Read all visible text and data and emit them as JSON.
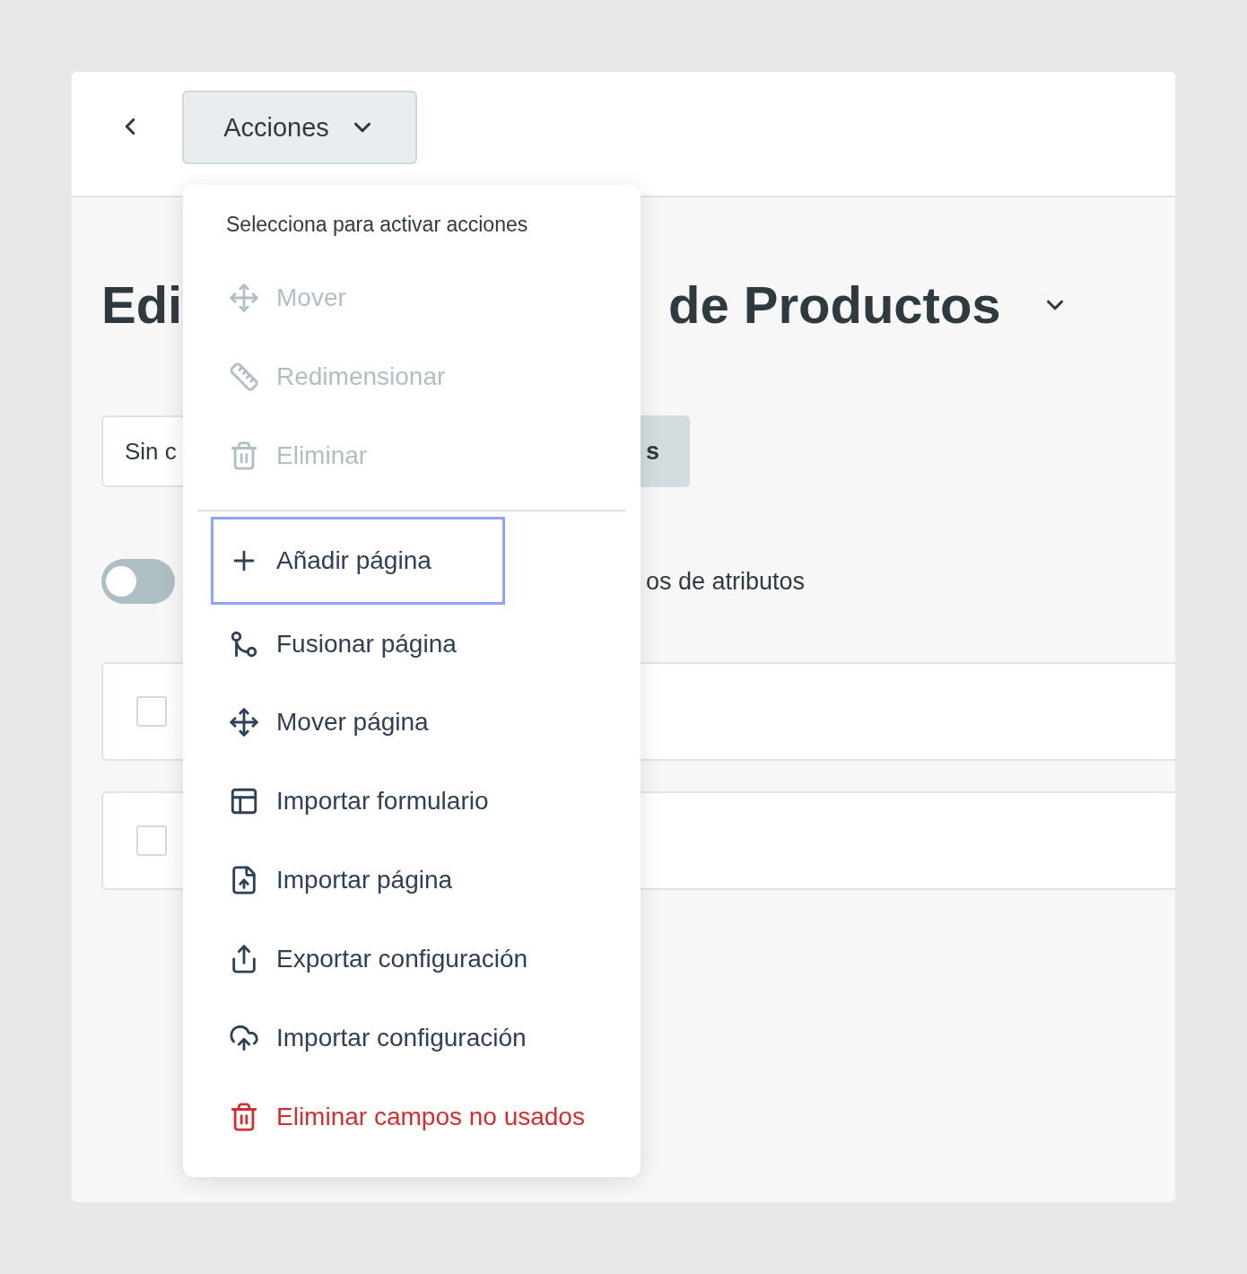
{
  "header": {
    "actions_button": {
      "label": "Acciones"
    }
  },
  "title": {
    "left": "Edi",
    "right": "de Productos"
  },
  "filter_field": {
    "value": "Sin c"
  },
  "filter_button": {
    "label": "s"
  },
  "toggle": {
    "on": false,
    "label": "os de atributos"
  },
  "rows": [
    {
      "checked": false
    },
    {
      "checked": false
    }
  ],
  "menu": {
    "header": "Selecciona para activar acciones",
    "groups": [
      {
        "items": [
          {
            "label": "Mover",
            "kind": "action",
            "disabled": true,
            "selected": false
          },
          {
            "label": "Redimensionar",
            "kind": "action",
            "disabled": true,
            "selected": false
          },
          {
            "label": "Eliminar",
            "kind": "action",
            "disabled": true,
            "selected": false
          }
        ]
      },
      {
        "items": [
          {
            "label": "Añadir página",
            "kind": "action",
            "disabled": false,
            "selected": true
          },
          {
            "label": "Fusionar página",
            "kind": "action",
            "disabled": false,
            "selected": false
          },
          {
            "label": "Mover página",
            "kind": "action",
            "disabled": false,
            "selected": false
          },
          {
            "label": "Importar formulario",
            "kind": "action",
            "disabled": false,
            "selected": false
          },
          {
            "label": "Importar página",
            "kind": "action",
            "disabled": false,
            "selected": false
          },
          {
            "label": "Exportar configuración",
            "kind": "action",
            "disabled": false,
            "selected": false
          },
          {
            "label": "Importar configuración",
            "kind": "action",
            "disabled": false,
            "selected": false
          },
          {
            "label": "Eliminar campos no usados",
            "kind": "danger",
            "disabled": false,
            "selected": false
          }
        ]
      }
    ]
  }
}
